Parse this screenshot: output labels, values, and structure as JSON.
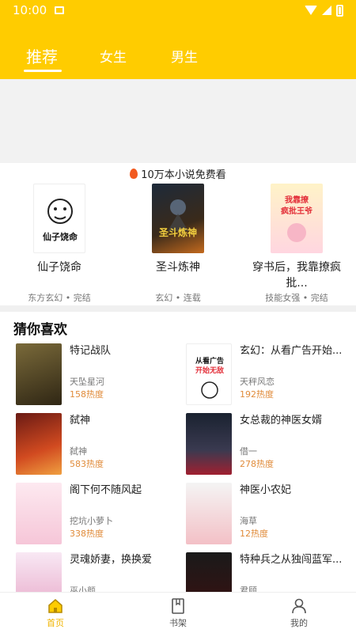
{
  "status": {
    "time": "10:00"
  },
  "tabs": [
    {
      "label": "推荐",
      "active": true
    },
    {
      "label": "女生",
      "active": false
    },
    {
      "label": "男生",
      "active": false
    }
  ],
  "promo": {
    "title": "10万本小说免费看",
    "books": [
      {
        "title": "仙子饶命",
        "meta": "东方玄幻 • 完结",
        "cover_text": "仙子饶命"
      },
      {
        "title": "圣斗炼神",
        "meta": "玄幻 • 连载",
        "cover_text": "圣斗炼神"
      },
      {
        "title": "穿书后，我靠撩疯批...",
        "meta": "技能女强 • 完结",
        "cover_text": "我靠撩疯批王爷"
      }
    ]
  },
  "guess": {
    "title": "猜你喜欢",
    "items": [
      {
        "title": "特记战队",
        "author": "天坠星河",
        "heat": "158热度"
      },
      {
        "title": "玄幻：从看广告开始...",
        "author": "天秤风恋",
        "heat": "192热度"
      },
      {
        "title": "弑神",
        "author": "弑神",
        "heat": "583热度"
      },
      {
        "title": "女总裁的神医女婿",
        "author": "借一",
        "heat": "278热度"
      },
      {
        "title": "阁下何不随风起",
        "author": "挖坑小萝卜",
        "heat": "338热度"
      },
      {
        "title": "神医小农妃",
        "author": "海草",
        "heat": "12热度"
      },
      {
        "title": "灵魂娇妻，换换爱",
        "author": "巫小颜",
        "heat": ""
      },
      {
        "title": "特种兵之从独闯蓝军...",
        "author": "君顾",
        "heat": ""
      }
    ]
  },
  "nav": [
    {
      "label": "首页",
      "active": true
    },
    {
      "label": "书架",
      "active": false
    },
    {
      "label": "我的",
      "active": false
    }
  ],
  "colors": {
    "brand": "#FFCC00",
    "heat": "#e08b3a",
    "nav_active": "#f0b400"
  }
}
